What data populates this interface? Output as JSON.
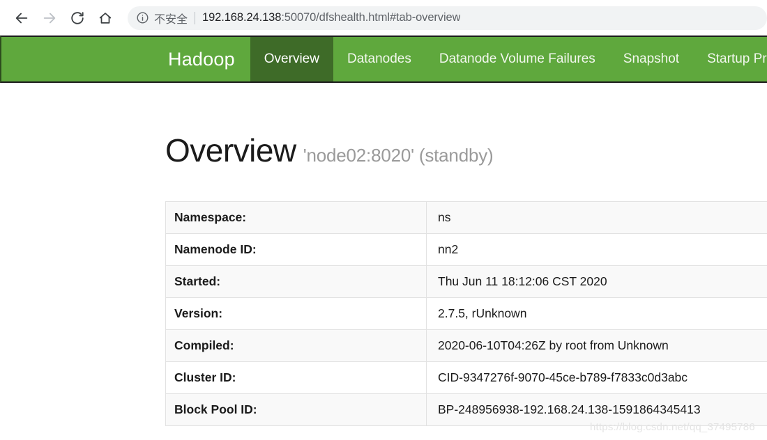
{
  "browser": {
    "back_icon": "back-arrow-icon",
    "forward_icon": "forward-arrow-icon",
    "reload_icon": "reload-icon",
    "home_icon": "home-icon",
    "security_icon": "info-circle-icon",
    "security_label": "不安全",
    "url_host": "192.168.24.138",
    "url_path": ":50070/dfshealth.html#tab-overview",
    "url_full": "192.168.24.138:50070/dfshealth.html#tab-overview"
  },
  "navbar": {
    "brand": "Hadoop",
    "background_color": "#5fa83d",
    "active_background_color": "#3e6b28",
    "items": [
      {
        "label": "Overview",
        "active": true
      },
      {
        "label": "Datanodes",
        "active": false
      },
      {
        "label": "Datanode Volume Failures",
        "active": false
      },
      {
        "label": "Snapshot",
        "active": false
      },
      {
        "label": "Startup Progre",
        "active": false
      }
    ]
  },
  "overview": {
    "title": "Overview",
    "subtitle": "'node02:8020' (standby)",
    "rows": [
      {
        "label": "Namespace:",
        "value": "ns"
      },
      {
        "label": "Namenode ID:",
        "value": "nn2"
      },
      {
        "label": "Started:",
        "value": "Thu Jun 11 18:12:06 CST 2020"
      },
      {
        "label": "Version:",
        "value": "2.7.5, rUnknown"
      },
      {
        "label": "Compiled:",
        "value": "2020-06-10T04:26Z by root from Unknown"
      },
      {
        "label": "Cluster ID:",
        "value": "CID-9347276f-9070-45ce-b789-f7833c0d3abc"
      },
      {
        "label": "Block Pool ID:",
        "value": "BP-248956938-192.168.24.138-1591864345413"
      }
    ]
  },
  "watermark": "https://blog.csdn.net/qq_37495786"
}
